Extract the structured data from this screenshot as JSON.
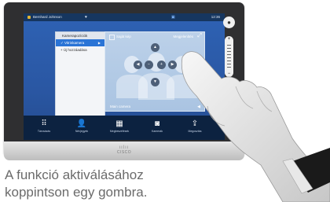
{
  "status_bar": {
    "user": "Bernhard Johnson",
    "time": "12:36"
  },
  "camera_panel": {
    "header": "Kamerapozíciók",
    "selected_item": "Vitrinkamera",
    "item": "Új hozzáadása"
  },
  "camera_view": {
    "toggle_label": "Saját kép",
    "preset_label": "Megjelenítés",
    "camera_name": "Main camera"
  },
  "dock": {
    "items": [
      {
        "icon": "keypad-icon",
        "label": "Tárcsázás"
      },
      {
        "icon": "contacts-icon",
        "label": "Névjegyek"
      },
      {
        "icon": "calendar-icon",
        "label": "Megbeszélések"
      },
      {
        "icon": "camera-icon",
        "label": "Kamerák"
      },
      {
        "icon": "share-icon",
        "label": "Megosztás"
      }
    ]
  },
  "device": {
    "brand": "CISCO"
  },
  "caption": {
    "line1": "A funkció aktiválásához",
    "line2": "koppintson egy gombra."
  }
}
